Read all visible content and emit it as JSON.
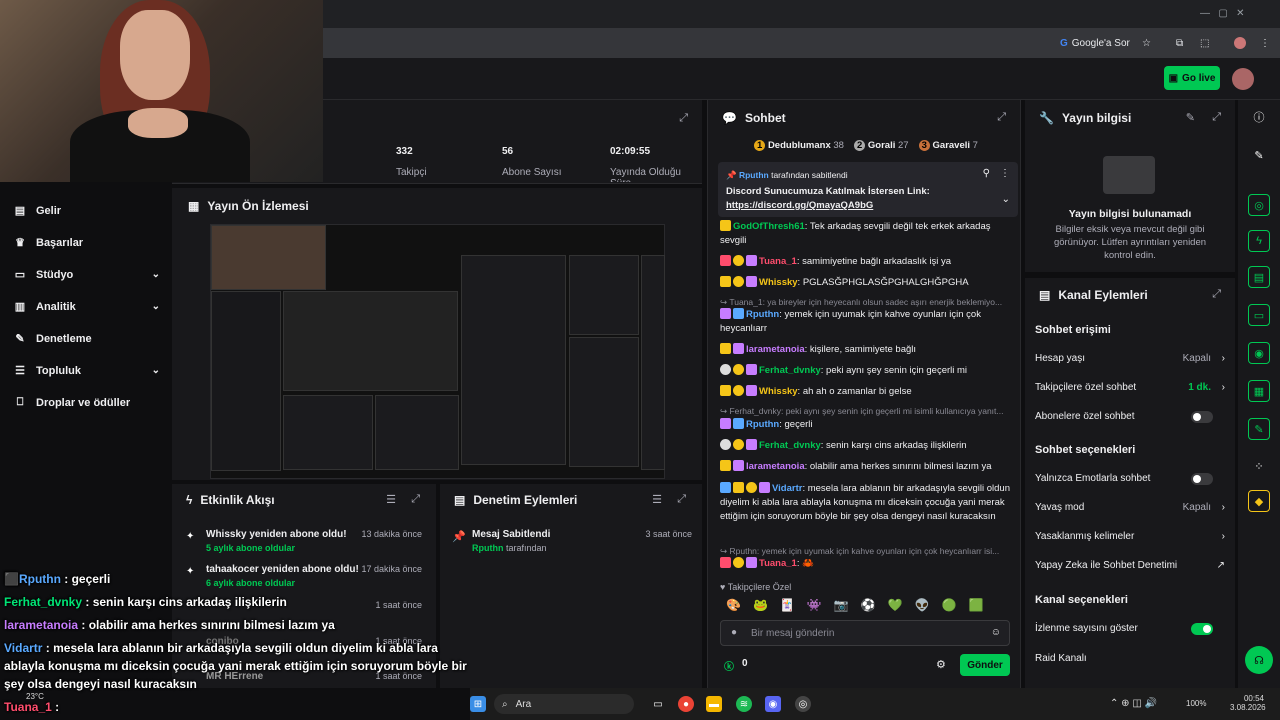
{
  "browser": {
    "google_sor": "Google'a Sor"
  },
  "topbar": {
    "golive_label": "Go live"
  },
  "nav": {
    "items": [
      {
        "label": "Gelir",
        "icon": "income-icon"
      },
      {
        "label": "Başarılar",
        "icon": "trophy-icon"
      },
      {
        "label": "Stüdyo",
        "icon": "studio-icon"
      },
      {
        "label": "Analitik",
        "icon": "analytics-icon"
      },
      {
        "label": "Denetleme",
        "icon": "wrench-icon"
      },
      {
        "label": "Topluluk",
        "icon": "people-icon"
      },
      {
        "label": "Droplar ve ödüller",
        "icon": "gift-icon"
      }
    ]
  },
  "stats": {
    "followers_value": "332",
    "followers_label": "Takipçi",
    "subs_value": "56",
    "subs_label": "Abone Sayısı",
    "uptime_value": "02:09:55",
    "uptime_label": "Yayında Olduğu Süre"
  },
  "preview": {
    "title": "Yayın Ön İzlemesi"
  },
  "activity": {
    "title": "Etkinlik Akışı",
    "items": [
      {
        "text": "Whissky yeniden abone oldu!",
        "sub": "5 aylık abone oldular",
        "time": "13 dakika önce"
      },
      {
        "text": "tahaakocer yeniden abone oldu!",
        "sub": "6 aylık abone oldular",
        "time": "17 dakika önce"
      },
      {
        "text": "",
        "sub": "",
        "time": "1 saat önce"
      },
      {
        "text": "conibo",
        "sub": "",
        "time": "1 saat önce"
      },
      {
        "text": "MR HErrene",
        "sub": "",
        "time": "1 saat önce"
      }
    ]
  },
  "moderation": {
    "title": "Denetim Eylemleri",
    "item_title": "Mesaj Sabitlendi",
    "item_user": "Rputhn",
    "item_suffix": "tarafından",
    "item_time": "3 saat önce"
  },
  "chat": {
    "title": "Sohbet",
    "leaderboard": [
      {
        "rank": "1",
        "name": "Dedublumanx",
        "count": "38"
      },
      {
        "rank": "2",
        "name": "Gorali",
        "count": "27"
      },
      {
        "rank": "3",
        "name": "Garaveli",
        "count": "7"
      }
    ],
    "pinned_by": "Rputhn",
    "pinned_by_suffix": "tarafından sabitlendi",
    "pinned_text": "Discord Sunucumuza Katılmak İstersen Link:",
    "pinned_link": "https://discord.gg/QmayaQA9bG",
    "lines": [
      {
        "user": "GodOfThresh61",
        "color": "#00c853",
        "text": ": Tek arkadaş sevgili değil tek erkek arkadaş sevgili"
      },
      {
        "user": "Tuana_1",
        "color": "#ff4d6d",
        "text": ": samimiyetine bağlı arkadaslık işi ya"
      },
      {
        "user": "Whissky",
        "color": "#f5c518",
        "text": ": PGLASĞPHGLASĞPGHALGHĞPGHA"
      },
      {
        "reply": "Tuana_1: ya bireyler için heyecanlı olsun sadec aşırı enerjik beklemiyo..."
      },
      {
        "user": "Rputhn",
        "color": "#5aa9ff",
        "text": ": yemek için uyumak için kahve oyunları için çok heycanlıarr"
      },
      {
        "user": "larametanoia",
        "color": "#c77dff",
        "text": ": kişilere, samimiyete bağlı"
      },
      {
        "user": "Ferhat_dvnky",
        "color": "#00c853",
        "text": ": peki aynı şey senin için geçerli mi"
      },
      {
        "user": "Whissky",
        "color": "#f5c518",
        "text": ": ah ah o zamanlar bi gelse"
      },
      {
        "reply": "Ferhat_dvnky: peki aynı şey senin için geçerli mi isimli kullanıcıya yanıt..."
      },
      {
        "user": "Rputhn",
        "color": "#5aa9ff",
        "text": ": geçerli"
      },
      {
        "user": "Ferhat_dvnky",
        "color": "#00c853",
        "text": ": senin karşı cins arkadaş ilişkilerin"
      },
      {
        "user": "larametanoia",
        "color": "#c77dff",
        "text": ": olabilir ama herkes sınırını bilmesi lazım ya"
      },
      {
        "user": "Vidartr",
        "color": "#5aa9ff",
        "text": ": mesela lara ablanın bir arkadaşıyla sevgili oldun diyelim ki abla lara ablayla konuşma mı diceksin çocuğa yani merak ettiğim için soruyorum böyle bir şey olsa dengeyi nasıl kuracaksın"
      },
      {
        "reply": "Rputhn: yemek için uyumak için kahve oyunları için çok heycanlıarr isi..."
      },
      {
        "user": "Tuana_1",
        "color": "#ff4d6d",
        "text": ":"
      }
    ],
    "followers_only": "Takipçilere Özel",
    "input_placeholder": "Bir mesaj gönderin",
    "points": "0",
    "send_label": "Gönder"
  },
  "streaminfo": {
    "title": "Yayın bilgisi",
    "empty_title": "Yayın bilgisi bulunamadı",
    "empty_desc": "Bilgiler eksik veya mevcut değil gibi görünüyor. Lütfen ayrıntıları yeniden kontrol edin."
  },
  "channelactions": {
    "title": "Kanal Eylemleri",
    "chat_access": "Sohbet erişimi",
    "account_age": "Hesap yaşı",
    "account_age_val": "Kapalı",
    "followers_chat": "Takipçilere özel sohbet",
    "followers_chat_val": "1 dk.",
    "subs_chat": "Abonelere özel sohbet",
    "chat_options": "Sohbet seçenekleri",
    "emote_only": "Yalnızca Emotlarla sohbet",
    "slow_mode": "Yavaş mod",
    "slow_mode_val": "Kapalı",
    "banned_words": "Yasaklanmış kelimeler",
    "ai_mod": "Yapay Zeka ile Sohbet Denetimi",
    "channel_options": "Kanal seçenekleri",
    "show_viewers": "İzlenme sayısını göster",
    "raid": "Raid Kanalı"
  },
  "overlay": {
    "lines": [
      {
        "user": "Rputhn",
        "color": "#5aa9ff",
        "text": " : geçerli"
      },
      {
        "user": "Ferhat_dvnky",
        "color": "#00e676",
        "text": " : senin karşı cins arkadaş ilişkilerin"
      },
      {
        "user": "larametanoia",
        "color": "#c77dff",
        "text": " : olabilir ama herkes sınırını bilmesi lazım ya"
      },
      {
        "user": "Vidartr",
        "color": "#5aa9ff",
        "text": " : mesela lara ablanın bir arkadaşıyla sevgili oldun diyelim ki abla lara"
      },
      {
        "user": "",
        "color": "#fff",
        "text": "ablayla konuşma mı diceksin çocuğa yani merak ettiğim için soruyorum böyle bir"
      },
      {
        "user": "",
        "color": "#fff",
        "text": "şey olsa dengeyi nasıl kuracaksın"
      },
      {
        "user": "Tuana_1",
        "color": "#ff4d6d",
        "text": " :"
      }
    ]
  },
  "taskbar": {
    "search": "Ara",
    "weather": "23°C",
    "time": "00:54",
    "date": "3.08.2026",
    "volume": "100%"
  }
}
